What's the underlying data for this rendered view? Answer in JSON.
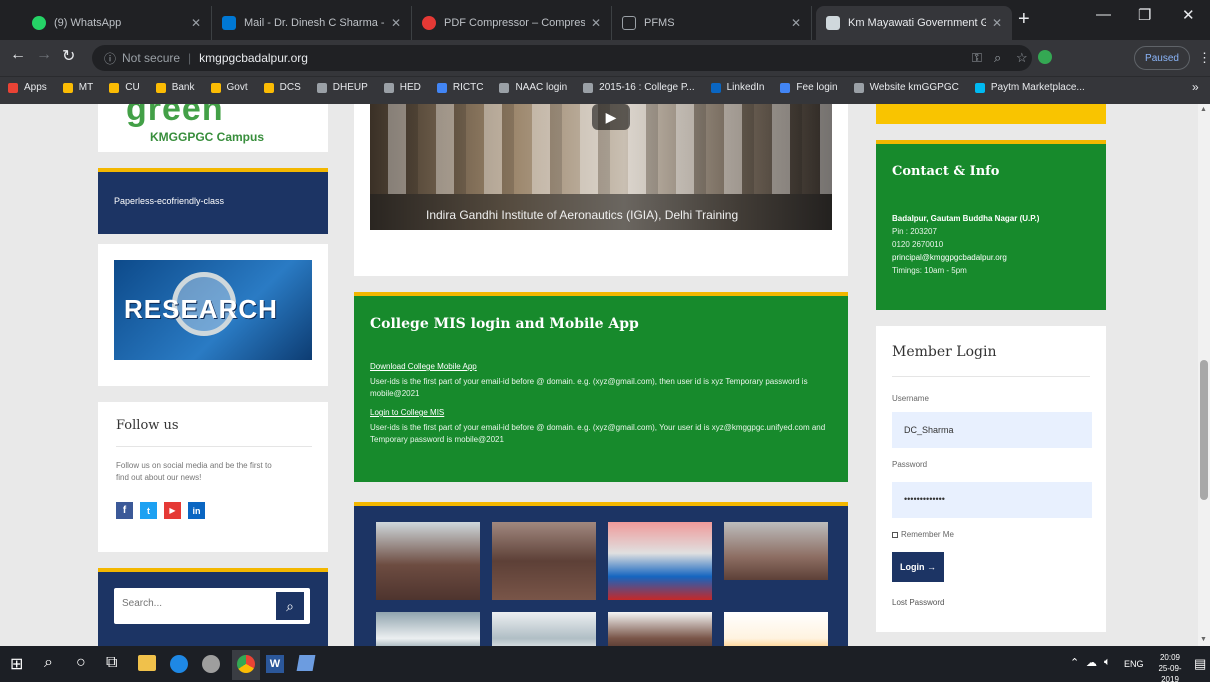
{
  "tabs": [
    {
      "title": "(9) WhatsApp",
      "color": "#25d366"
    },
    {
      "title": "Mail - Dr. Dinesh C Sharma - (",
      "color": "#0078d4"
    },
    {
      "title": "PDF Compressor – Compress",
      "color": "#e53935"
    },
    {
      "title": "PFMS",
      "color": "#9e9e9e"
    },
    {
      "title": "Km Mayawati Government Gi",
      "color": "#cfd8dc"
    }
  ],
  "address": {
    "security": "Not secure",
    "url": "kmgpgcbadalpur.org",
    "paused": "Paused"
  },
  "bookmarks": [
    {
      "label": "Apps",
      "color": "#ea4335"
    },
    {
      "label": "MT",
      "color": "#fbbc04"
    },
    {
      "label": "CU",
      "color": "#fbbc04"
    },
    {
      "label": "Bank",
      "color": "#fbbc04"
    },
    {
      "label": "Govt",
      "color": "#fbbc04"
    },
    {
      "label": "DCS",
      "color": "#fbbc04"
    },
    {
      "label": "DHEUP",
      "color": "#9aa0a6"
    },
    {
      "label": "HED",
      "color": "#9aa0a6"
    },
    {
      "label": "RICTC",
      "color": "#4285f4"
    },
    {
      "label": "NAAC login",
      "color": "#9aa0a6"
    },
    {
      "label": "2015-16 : College P...",
      "color": "#9aa0a6"
    },
    {
      "label": "LinkedIn",
      "color": "#0a66c2"
    },
    {
      "label": "Fee login",
      "color": "#4285f4"
    },
    {
      "label": "Website kmGGPGC",
      "color": "#9aa0a6"
    },
    {
      "label": "Paytm Marketplace...",
      "color": "#00baf2"
    }
  ],
  "left": {
    "green_campus_big": "green",
    "green_campus_small": "KMGGPGC Campus",
    "paperless": "Paperless-ecofriendly-class",
    "research": "RESEARCH",
    "follow_title": "Follow us",
    "follow_text": "Follow us on social media and be the first to find out about our news!",
    "social": [
      "f",
      "t",
      "▶",
      "in"
    ],
    "search_placeholder": "Search..."
  },
  "center": {
    "video_caption": "Indira Gandhi Institute of Aeronautics (IGIA), Delhi Training",
    "mis_title": "College MIS login and Mobile App",
    "mis_link1": "Download College Mobile App",
    "mis_text1": "User-ids is the first part of your email-id before @ domain. e.g. (xyz@gmail.com), then user id is xyz Temporary password is mobile@2021",
    "mis_link2": "Login to College MIS",
    "mis_text2": "User-ids is the first part of your email-id before @ domain. e.g. (xyz@gmail.com), Your user id is xyz@kmggpgc.unifyed.com and Temporary password is mobile@2021"
  },
  "right": {
    "contact_title": "Contact & Info",
    "addr": "Badalpur, Gautam Buddha Nagar (U.P.)",
    "pin": "Pin : 203207",
    "phone": "0120 2670010",
    "email": "principal@kmggpgcbadalpur.org",
    "timings": "Timings: 10am - 5pm",
    "login_title": "Member Login",
    "username_label": "Username",
    "username_value": "DC_Sharma",
    "password_label": "Password",
    "password_value": "•••••••••••••",
    "remember": "Remember Me",
    "login_button": "Login →",
    "lost": "Lost Password"
  },
  "taskbar": {
    "lang": "ENG",
    "time": "20:09",
    "date": "25-09-2019"
  }
}
